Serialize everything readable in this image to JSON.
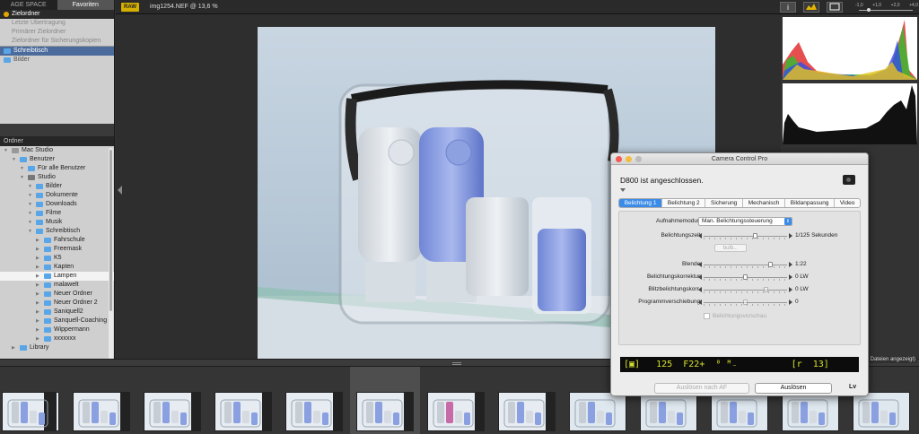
{
  "left_panel": {
    "tabs": [
      "AGE SPACE",
      "Favoriten"
    ],
    "favorites": [
      {
        "label": "Zielordner",
        "state": "selected",
        "icon": "target-icon"
      },
      {
        "label": "Letzte Übertragung",
        "state": "dim",
        "icon": "none"
      },
      {
        "label": "Primärer Zielordner",
        "state": "dim",
        "icon": "none"
      },
      {
        "label": "Zielordner für Sicherungskopien",
        "state": "dim",
        "icon": "none"
      },
      {
        "label": "Schreibtisch",
        "state": "blue",
        "icon": "folder-icon"
      },
      {
        "label": "Bilder",
        "state": "normal",
        "icon": "folder-icon"
      }
    ],
    "ordner_header": "Ordner",
    "tree": [
      {
        "label": "Mac Studio",
        "depth": 0,
        "icon": "computer-icon"
      },
      {
        "label": "Benutzer",
        "depth": 1,
        "icon": "folder-icon"
      },
      {
        "label": "Für alle Benutzer",
        "depth": 2,
        "icon": "folder-icon"
      },
      {
        "label": "Studio",
        "depth": 2,
        "icon": "home-icon"
      },
      {
        "label": "Bilder",
        "depth": 3,
        "icon": "folder-icon"
      },
      {
        "label": "Dokumente",
        "depth": 3,
        "icon": "folder-icon"
      },
      {
        "label": "Downloads",
        "depth": 3,
        "icon": "folder-icon"
      },
      {
        "label": "Filme",
        "depth": 3,
        "icon": "folder-icon"
      },
      {
        "label": "Musik",
        "depth": 3,
        "icon": "folder-icon"
      },
      {
        "label": "Schreibtisch",
        "depth": 3,
        "icon": "folder-icon"
      },
      {
        "label": "Fahrschule",
        "depth": 4,
        "icon": "folder-icon"
      },
      {
        "label": "Freemask",
        "depth": 4,
        "icon": "folder-icon"
      },
      {
        "label": "K5",
        "depth": 4,
        "icon": "folder-icon"
      },
      {
        "label": "Kapten",
        "depth": 4,
        "icon": "folder-icon"
      },
      {
        "label": "Lampen",
        "depth": 4,
        "icon": "folder-icon",
        "selected": true
      },
      {
        "label": "malawelt",
        "depth": 4,
        "icon": "folder-icon"
      },
      {
        "label": "Neuer Ordner",
        "depth": 4,
        "icon": "folder-icon"
      },
      {
        "label": "Neuer Ordner 2",
        "depth": 4,
        "icon": "folder-icon"
      },
      {
        "label": "Saniquell2",
        "depth": 4,
        "icon": "folder-icon"
      },
      {
        "label": "Sanquell-Coaching",
        "depth": 4,
        "icon": "folder-icon"
      },
      {
        "label": "Wippermann",
        "depth": 4,
        "icon": "folder-icon"
      },
      {
        "label": "xxxxxxx",
        "depth": 4,
        "icon": "folder-icon"
      },
      {
        "label": "Library",
        "depth": 1,
        "icon": "folder-icon"
      }
    ]
  },
  "topbar": {
    "raw_badge": "RAW",
    "filename": "img1254.NEF @ 13,6 %",
    "info_icon": "info-icon",
    "zoom_labels": [
      "-1,0",
      "+1,0",
      "+2,0",
      "+4,0"
    ],
    "zoom_level_fraction": 0.15
  },
  "filmstrip": {
    "status": "Dateien angezeigt)",
    "thumbnail_count": 13,
    "selected_index": 5
  },
  "dialog": {
    "title": "Camera Control Pro",
    "status": "D800 ist angeschlossen.",
    "tabs": [
      "Belichtung 1",
      "Belichtung 2",
      "Sicherung",
      "Mechanisch",
      "Bildanpassung",
      "Video"
    ],
    "active_tab": 0,
    "aufnahmemodus_label": "Aufnahmemodus:",
    "aufnahmemodus_value": "Man. Belichtungssteuerung",
    "belichtungszeit_label": "Belichtungszeit:",
    "belichtungszeit_value": "1/125 Sekunden",
    "belichtungszeit_pos": 0.62,
    "bulb_label": "bulb...",
    "blende_label": "Blende:",
    "blende_value": "1:22",
    "blende_pos": 0.8,
    "belichtungskorrektur_label": "Belichtungskorrektur:",
    "belichtungskorrektur_value": "0 LW",
    "belichtungskorrektur_pos": 0.5,
    "blitz_label": "Blitzbelichtungskorr.:",
    "blitz_value": "0 LW",
    "blitz_pos": 0.75,
    "programm_label": "Programmverschiebung:",
    "programm_value": "0",
    "programm_pos": 0.5,
    "vorschau_label": "Belichtungsvorschau",
    "lcd": "[▣]   125  F22+  ⁰ ᴹ₋          [r  13]",
    "af_button": "Auslösen nach AF",
    "release_button": "Auslösen",
    "lv": "Lv"
  },
  "colors": {
    "accent": "#3b8ce8",
    "lcd_text": "#d7e32e",
    "raw_badge": "#d4b000"
  }
}
